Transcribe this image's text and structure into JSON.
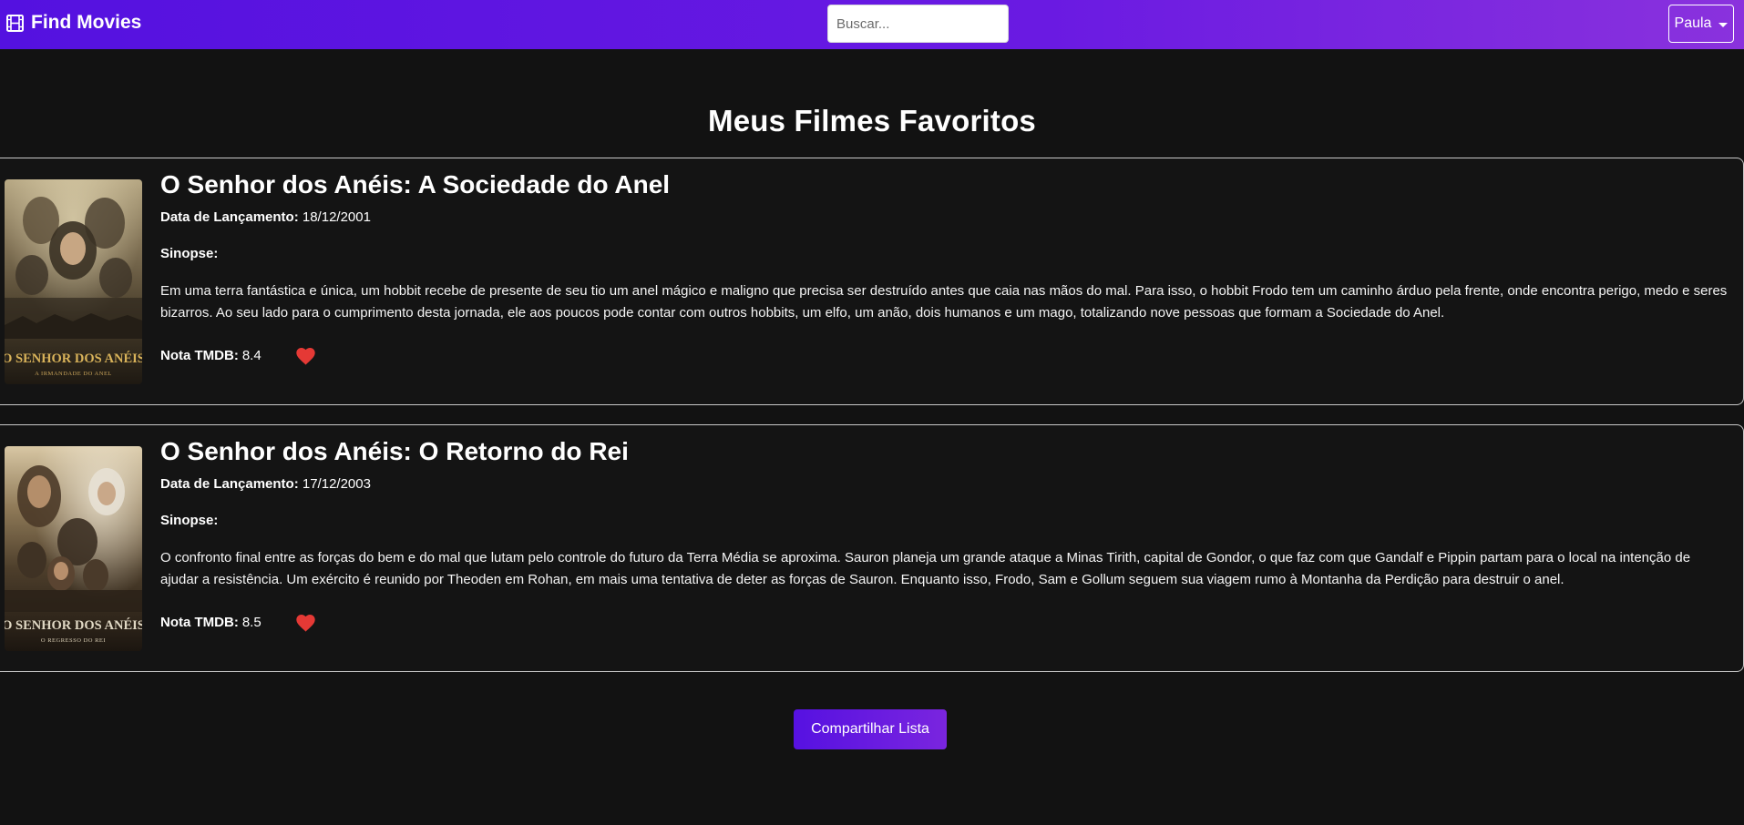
{
  "navbar": {
    "brand": "Find Movies",
    "brand_icon": "film-icon",
    "search_placeholder": "Buscar...",
    "search_value": "",
    "user_name": "Paula"
  },
  "page": {
    "title": "Meus Filmes Favoritos",
    "share_label": "Compartilhar Lista"
  },
  "labels": {
    "release": "Data de Lançamento:",
    "synopsis": "Sinopse:",
    "rating": "Nota TMDB:"
  },
  "movies": [
    {
      "title": "O Senhor dos Anéis: A Sociedade do Anel",
      "release_date": "18/12/2001",
      "synopsis": "Em uma terra fantástica e única, um hobbit recebe de presente de seu tio um anel mágico e maligno que precisa ser destruído antes que caia nas mãos do mal. Para isso, o hobbit Frodo tem um caminho árduo pela frente, onde encontra perigo, medo e seres bizarros. Ao seu lado para o cumprimento desta jornada, ele aos poucos pode contar com outros hobbits, um elfo, um anão, dois humanos e um mago, totalizando nove pessoas que formam a Sociedade do Anel.",
      "rating": "8.4",
      "favorite": true,
      "poster_title": "O SENHOR DOS ANÉIS",
      "poster_subtitle": "A IRMANDADE DO ANEL"
    },
    {
      "title": "O Senhor dos Anéis: O Retorno do Rei",
      "release_date": "17/12/2003",
      "synopsis": "O confronto final entre as forças do bem e do mal que lutam pelo controle do futuro da Terra Média se aproxima. Sauron planeja um grande ataque a Minas Tirith, capital de Gondor, o que faz com que Gandalf e Pippin partam para o local na intenção de ajudar a resistência. Um exército é reunido por Theoden em Rohan, em mais uma tentativa de deter as forças de Sauron. Enquanto isso, Frodo, Sam e Gollum seguem sua viagem rumo à Montanha da Perdição para destruir o anel.",
      "rating": "8.5",
      "favorite": true,
      "poster_title": "O SENHOR DOS ANÉIS",
      "poster_subtitle": "O REGRESSO DO REI"
    }
  ],
  "colors": {
    "navbar_start": "#5411e0",
    "navbar_end": "#8a32dd",
    "background": "#121212",
    "heart": "#e53935",
    "poster_title": "#d9b35a"
  }
}
